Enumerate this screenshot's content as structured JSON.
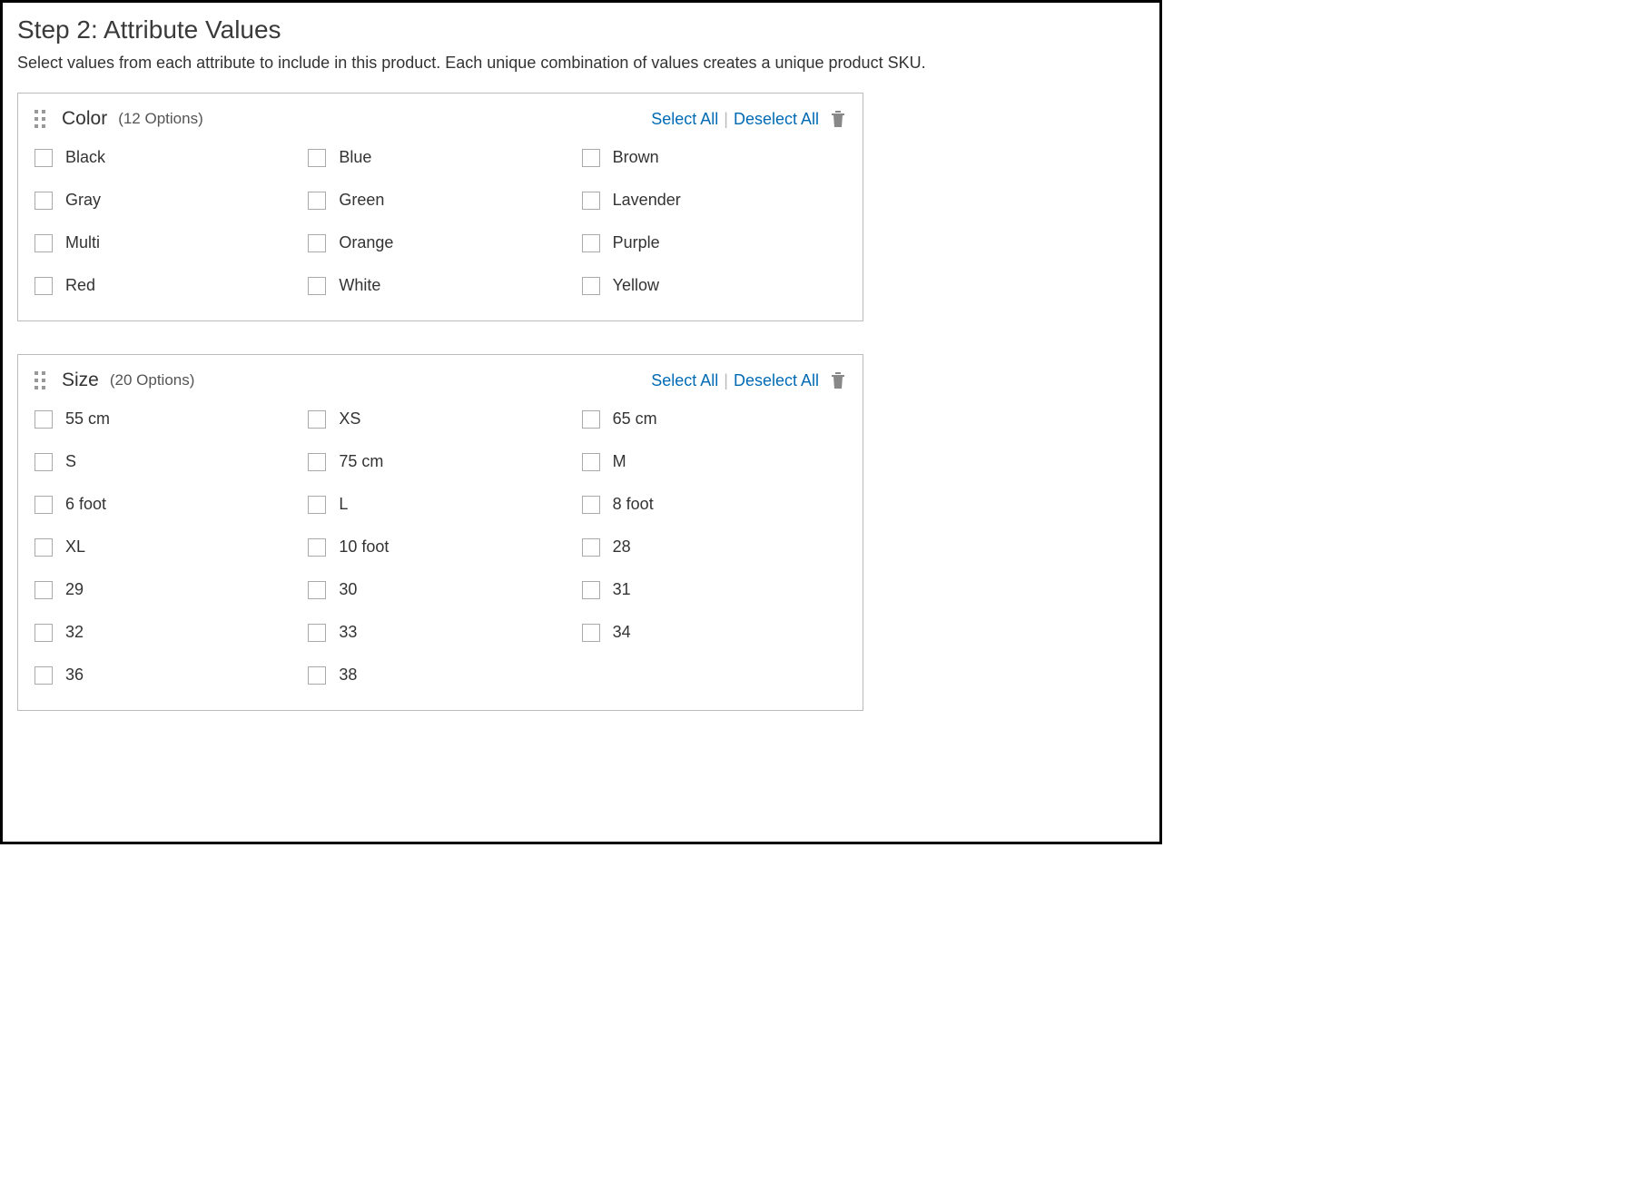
{
  "step": {
    "title": "Step 2: Attribute Values",
    "description": "Select values from each attribute to include in this product. Each unique combination of values creates a unique product SKU."
  },
  "actions": {
    "select_all": "Select All",
    "deselect_all": "Deselect All"
  },
  "attributes": [
    {
      "name": "Color",
      "count_label": "(12 Options)",
      "options": [
        "Black",
        "Blue",
        "Brown",
        "Gray",
        "Green",
        "Lavender",
        "Multi",
        "Orange",
        "Purple",
        "Red",
        "White",
        "Yellow"
      ]
    },
    {
      "name": "Size",
      "count_label": "(20 Options)",
      "options": [
        "55 cm",
        "XS",
        "65 cm",
        "S",
        "75 cm",
        "M",
        "6 foot",
        "L",
        "8 foot",
        "XL",
        "10 foot",
        "28",
        "29",
        "30",
        "31",
        "32",
        "33",
        "34",
        "36",
        "38"
      ]
    }
  ]
}
